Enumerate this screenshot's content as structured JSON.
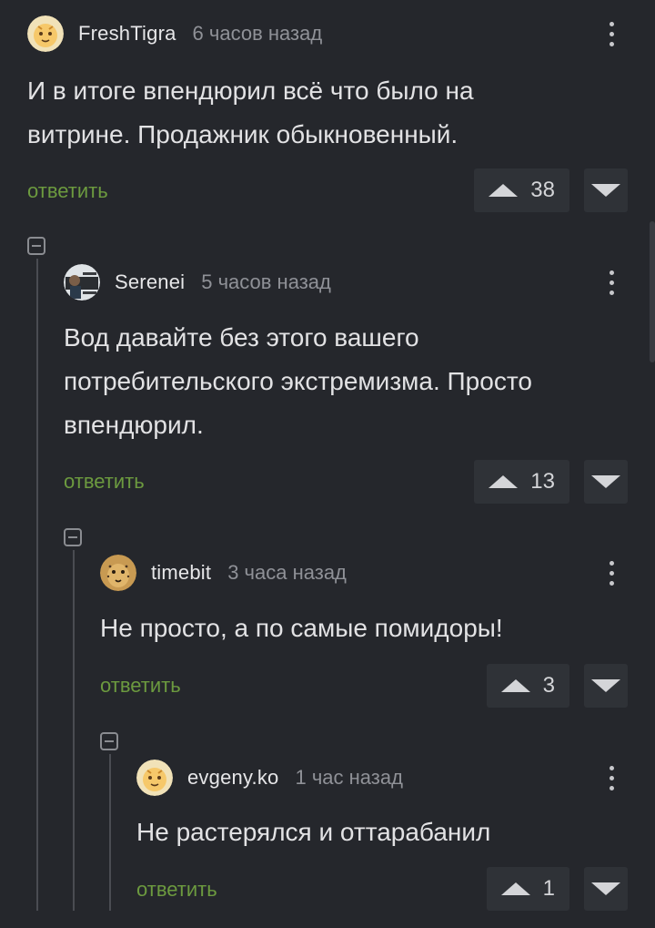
{
  "comments": [
    {
      "username": "FreshTigra",
      "time": "6 часов назад",
      "text": "И в итоге впендюрил всё что было на витрине. Продажник обыкновенный.",
      "reply_label": "ответить",
      "votes": "38",
      "avatar_icon": "tiger-avatar-icon"
    },
    {
      "username": "Serenei",
      "time": "5 часов назад",
      "text": "Вод давайте без этого вашего потребительского экстремизма. Просто впендюрил.",
      "reply_label": "ответить",
      "votes": "13",
      "avatar_icon": "user-photo-avatar"
    },
    {
      "username": "timebit",
      "time": "3 часа назад",
      "text": "Не просто, а по самые помидоры!",
      "reply_label": "ответить",
      "votes": "3",
      "avatar_icon": "cheetah-avatar"
    },
    {
      "username": "evgeny.ko",
      "time": "1 час назад",
      "text": "Не растерялся и оттарабанил",
      "reply_label": "ответить",
      "votes": "1",
      "avatar_icon": "default-avatar-icon"
    }
  ],
  "colors": {
    "background": "#25272c",
    "reply_link": "#6c9a3f",
    "vote_box": "#2f3237",
    "text": "#e2e2e4",
    "muted": "#8f9197"
  }
}
